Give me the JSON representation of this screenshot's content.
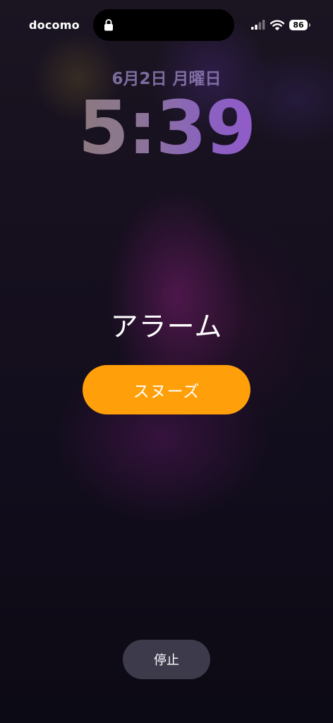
{
  "status_bar": {
    "carrier": "docomo",
    "battery_level": "86",
    "signal_icon": "cellular-signal-icon",
    "wifi_icon": "wifi-icon",
    "lock_icon": "lock-icon"
  },
  "lock_screen": {
    "date": "6月2日 月曜日",
    "time": "5:39"
  },
  "alarm": {
    "title": "アラーム",
    "snooze_label": "スヌーズ",
    "stop_label": "停止"
  },
  "colors": {
    "snooze_button": "#ff9f0a",
    "background": "#150f1e"
  }
}
